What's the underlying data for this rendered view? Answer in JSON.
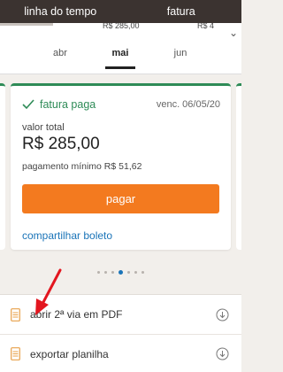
{
  "top_tabs": [
    {
      "label": "linha do tempo"
    },
    {
      "label": "fatura"
    }
  ],
  "peek_chart": {
    "labels": [
      "R$ 285,00",
      "R$ 4"
    ]
  },
  "months": [
    {
      "label": "abr"
    },
    {
      "label": "mai"
    },
    {
      "label": "jun"
    }
  ],
  "active_month": "mai",
  "card": {
    "status": "fatura paga",
    "due": "venc. 06/05/20",
    "total_label": "valor total",
    "total_value": "R$ 285,00",
    "min_payment": "pagamento mínimo R$ 51,62",
    "pay_button": "pagar",
    "share_link": "compartilhar boleto"
  },
  "pager": {
    "count": 7,
    "active_index": 3
  },
  "list": [
    {
      "label": "abrir 2ª via em PDF",
      "icon": "document-icon",
      "action_icon": "download-icon"
    },
    {
      "label": "exportar planilha",
      "icon": "document-icon",
      "action_icon": "download-icon"
    }
  ],
  "colors": {
    "top_bar": "#3b3330",
    "accent_green": "#2e8b57",
    "pay_orange": "#f37a1f",
    "link_blue": "#1a74b8",
    "annotation_red": "#e3161f",
    "doc_icon_orange": "#e8a04a"
  }
}
